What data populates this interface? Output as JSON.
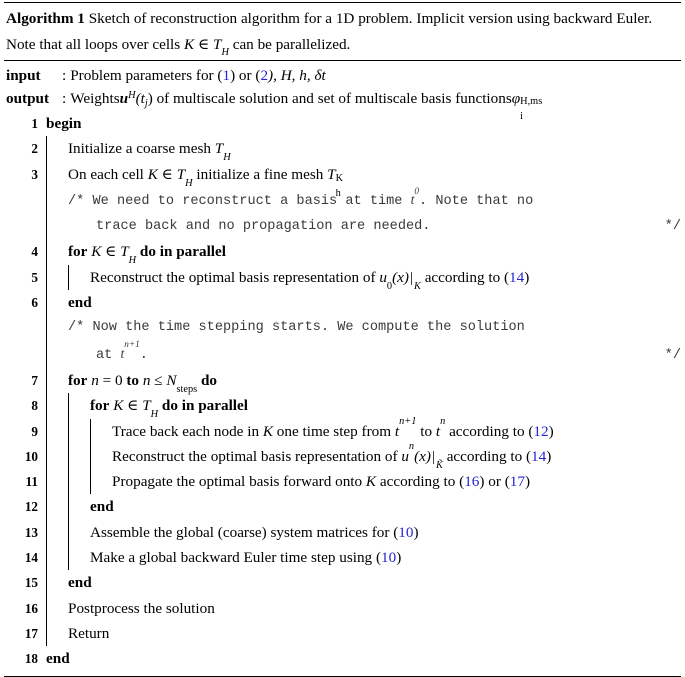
{
  "caption": {
    "label": "Algorithm 1",
    "text_line1": "Sketch of reconstruction algorithm for a 1D problem. Implicit version using",
    "text_line2_a": "backward Euler. Note that all loops over cells ",
    "text_line2_math": "K ∈ \u0001H",
    "text_line2_b": " can be parallelized."
  },
  "io": {
    "input_label": "input",
    "input_sep": ":",
    "input_text_a": "Problem parameters for (",
    "input_ref1": "1",
    "input_text_b": ") or (",
    "input_ref2": "2",
    "input_text_c": "), H, h, δt",
    "output_label": "output",
    "output_sep": ":",
    "output_text_a": "Weights ",
    "output_math_u": "u",
    "output_sup_H": "H",
    "output_tj": "(t",
    "output_sub_j": "j",
    "output_text_b": ") of multiscale solution and set of multiscale basis functions ",
    "output_phi": "φ",
    "output_phi_sub": "i",
    "output_phi_sup": "H,ms"
  },
  "lines": [
    {
      "no": "1",
      "kind": "code",
      "text": "begin"
    },
    {
      "no": "2",
      "kind": "code",
      "text": "Initialize a coarse mesh \u0001H"
    },
    {
      "no": "3",
      "kind": "code",
      "text": "On each cell K ∈ \u0001H initialize a fine mesh \u0001h^K"
    },
    {
      "no": "",
      "kind": "comment",
      "text": "/* We need to reconstruct a basis at time t0. Note that no",
      "text2": "trace back and no propagation are needed.",
      "end": "*/"
    },
    {
      "no": "4",
      "kind": "code",
      "text": "for K ∈ \u0001H do in parallel"
    },
    {
      "no": "5",
      "kind": "code",
      "text": "Reconstruct the optimal basis representation of u0(x)|K according to (14)"
    },
    {
      "no": "6",
      "kind": "code",
      "text": "end"
    },
    {
      "no": "",
      "kind": "comment",
      "text": "/* Now the time stepping starts. We compute the solution",
      "text2": "at tn+1.",
      "end": "*/"
    },
    {
      "no": "7",
      "kind": "code",
      "text": "for n = 0 to n ≤ Nsteps do"
    },
    {
      "no": "8",
      "kind": "code",
      "text": "for K ∈ \u0001H do in parallel"
    },
    {
      "no": "9",
      "kind": "code",
      "text": "Trace back each node in K one time step from tn+1 to tn according to (12)"
    },
    {
      "no": "10",
      "kind": "code",
      "text": "Reconstruct the optimal basis representation of un(x)|K̃ according to (14)"
    },
    {
      "no": "11",
      "kind": "code",
      "text": "Propagate the optimal basis forward onto K according to (16) or (17)"
    },
    {
      "no": "12",
      "kind": "code",
      "text": "end"
    },
    {
      "no": "13",
      "kind": "code",
      "text": "Assemble the global (coarse) system matrices for (10)"
    },
    {
      "no": "14",
      "kind": "code",
      "text": "Make a global backward Euler time step using (10)"
    },
    {
      "no": "15",
      "kind": "code",
      "text": "end"
    },
    {
      "no": "16",
      "kind": "code",
      "text": "Postprocess the solution"
    },
    {
      "no": "17",
      "kind": "code",
      "text": "Return"
    },
    {
      "no": "18",
      "kind": "code",
      "text": "end"
    }
  ],
  "line_numbers": {
    "n1": "1",
    "n2": "2",
    "n3": "3",
    "n4": "4",
    "n5": "5",
    "n6": "6",
    "n7": "7",
    "n8": "8",
    "n9": "9",
    "n10": "10",
    "n11": "11",
    "n12": "12",
    "n13": "13",
    "n14": "14",
    "n15": "15",
    "n16": "16",
    "n17": "17",
    "n18": "18"
  },
  "text": {
    "begin": "begin",
    "end": "end",
    "l2_a": "Initialize a coarse mesh ",
    "l3_a": "On each cell ",
    "l3_b": " initialize a fine mesh ",
    "in_sym": "∈",
    "le_sym": "≤",
    "K": "K",
    "c1_a": "/* We need to reconstruct a basis at time ",
    "c1_t": "t",
    "c1_sup": "0",
    "c1_b": ". Note that no",
    "c1_line2": "trace back and no propagation are needed.",
    "c_end": "*/",
    "l4_for": "for",
    "l4_do": "do in parallel",
    "l5": "Reconstruct the optimal basis representation of ",
    "l5_u": "u",
    "l5_sub": "0",
    "l5_x": "(x)",
    "l5_bar_sub": "K",
    "l5_acc": " according to (",
    "l5_ref": "14",
    "close": ")",
    "c2_a": "/* Now the time stepping starts. We compute the solution",
    "c2_b": "at ",
    "c2_t": "t",
    "c2_sup": "n+1",
    "c2_dot": ".",
    "l7_a": "for",
    "l7_b": "n",
    "l7_c": "= 0",
    "l7_to": "to",
    "l7_d": "n",
    "l7_N": "N",
    "l7_Nsub": "steps",
    "l7_do": "do",
    "l9_a": "Trace back each node in ",
    "l9_b": " one time step from ",
    "l9_t": "t",
    "l9_sup1": "n+1",
    "l9_to": " to ",
    "l9_sup2": "n",
    "l9_acc": " according to (",
    "l9_ref": "12",
    "l10_a": "Reconstruct the optimal basis representation of ",
    "l10_u": "u",
    "l10_sup": "n",
    "l10_x": "(x)",
    "l10_Ktilde": "K̃",
    "l10_acc": " according to (",
    "l10_ref": "14",
    "l11_a": "Propagate the optimal basis forward onto ",
    "l11_b": " according to (",
    "l11_ref1": "16",
    "l11_or": ") or (",
    "l11_ref2": "17",
    "l13_a": "Assemble the global (coarse) system matrices for (",
    "l13_ref": "10",
    "l14_a": "Make a global backward Euler time step using (",
    "l14_ref": "10",
    "l16": "Postprocess the solution",
    "l17": "Return",
    "TH": "T",
    "TH_sub": "H",
    "Th": "T",
    "Th_sub": "h",
    "Th_sup": "K"
  },
  "colors": {
    "reference_link": "#2424d6",
    "comment_text": "#3a3a3a",
    "body_text": "#000000",
    "rule": "#000000"
  }
}
